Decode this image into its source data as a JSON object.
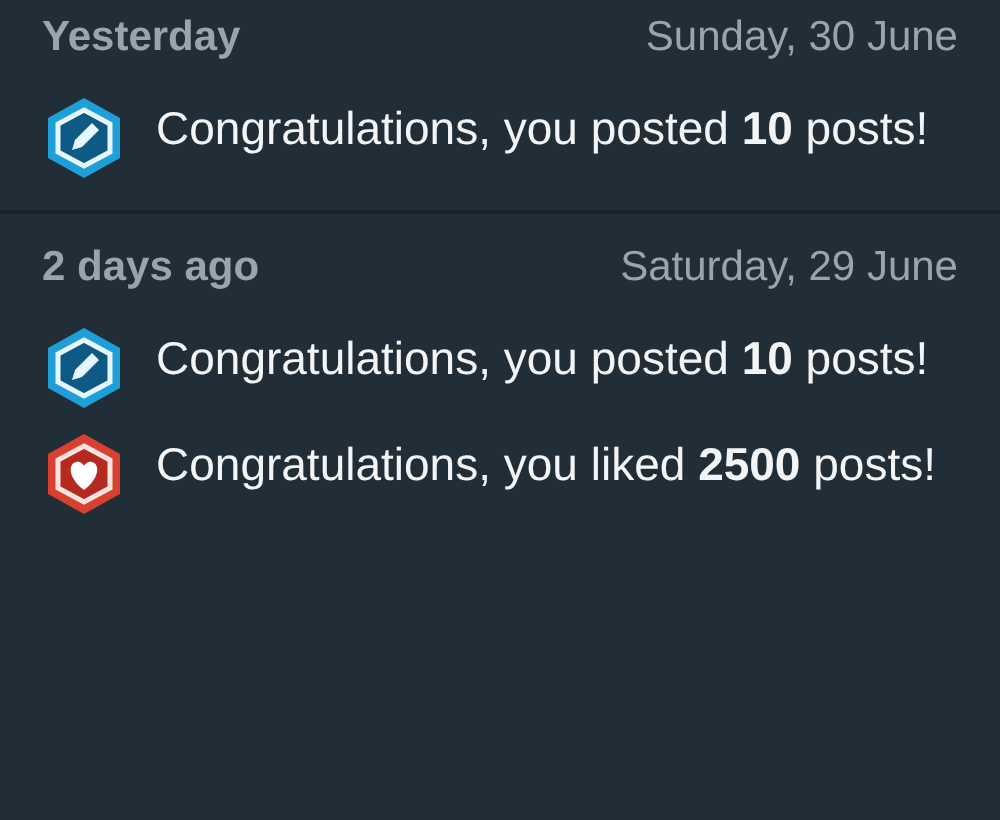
{
  "sections": [
    {
      "relative": "Yesterday",
      "date": "Sunday, 30 June",
      "items": [
        {
          "kind": "post",
          "text": "Congratulations, you posted **10** posts!"
        }
      ]
    },
    {
      "relative": "2 days ago",
      "date": "Saturday, 29 June",
      "items": [
        {
          "kind": "post",
          "text": "Congratulations, you posted **10** posts!"
        },
        {
          "kind": "like",
          "text": "Congratulations, you liked **2500** posts!"
        }
      ]
    }
  ]
}
